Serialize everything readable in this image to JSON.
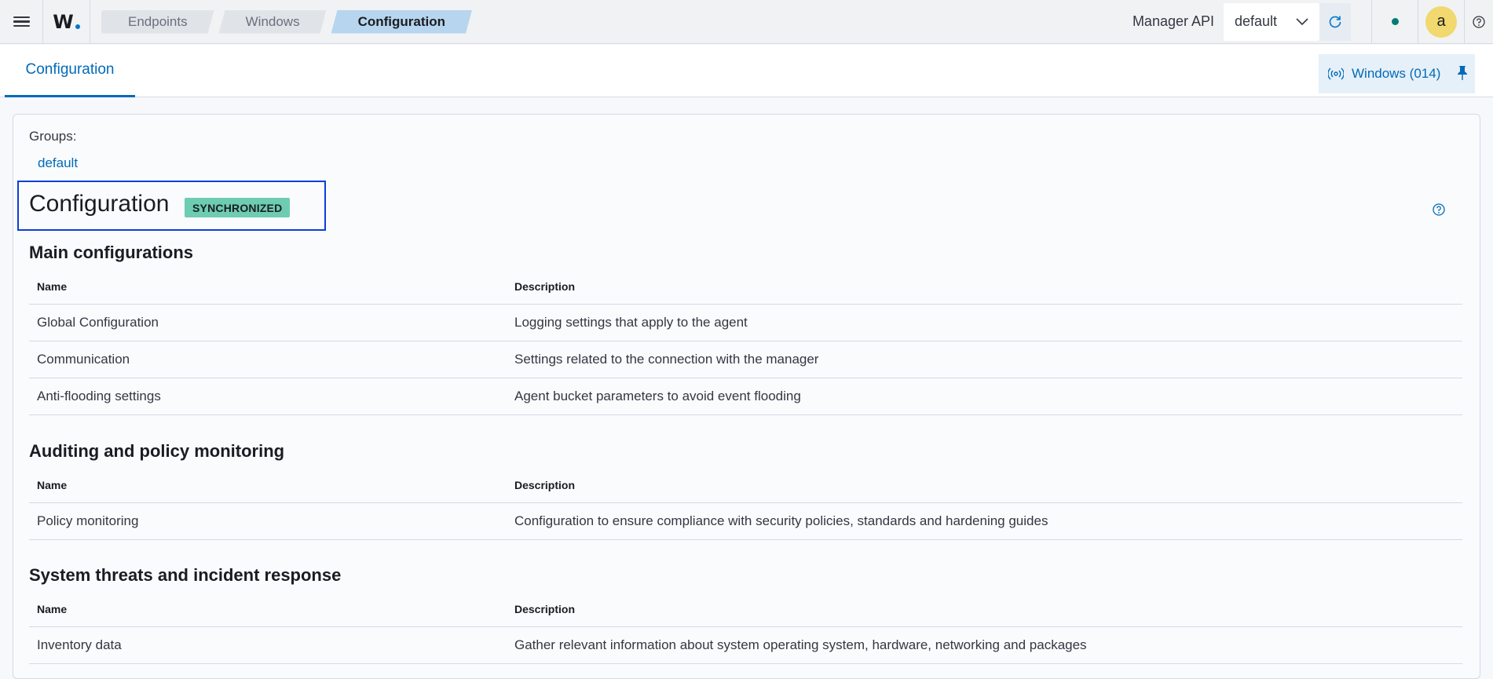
{
  "header": {
    "breadcrumbs": [
      "Endpoints",
      "Windows",
      "Configuration"
    ],
    "manager_api_label": "Manager API",
    "api_selected": "default",
    "avatar_letter": "a"
  },
  "subheader": {
    "tab_label": "Configuration",
    "agent_button_label": "Windows (014)"
  },
  "main": {
    "groups_label": "Groups:",
    "group_link": "default",
    "title": "Configuration",
    "status_badge": "SYNCHRONIZED",
    "column_headers": {
      "name": "Name",
      "description": "Description"
    },
    "sections": [
      {
        "title": "Main configurations",
        "rows": [
          {
            "name": "Global Configuration",
            "description": "Logging settings that apply to the agent"
          },
          {
            "name": "Communication",
            "description": "Settings related to the connection with the manager"
          },
          {
            "name": "Anti-flooding settings",
            "description": "Agent bucket parameters to avoid event flooding"
          }
        ]
      },
      {
        "title": "Auditing and policy monitoring",
        "rows": [
          {
            "name": "Policy monitoring",
            "description": "Configuration to ensure compliance with security policies, standards and hardening guides"
          }
        ]
      },
      {
        "title": "System threats and incident response",
        "rows": [
          {
            "name": "Inventory data",
            "description": "Gather relevant information about system operating system, hardware, networking and packages"
          }
        ]
      }
    ]
  },
  "colors": {
    "accent": "#006bb8",
    "badge": "#6dccb1",
    "status_online": "#017d73",
    "avatar": "#f1d86f",
    "highlight_box": "#0b3fd6"
  }
}
